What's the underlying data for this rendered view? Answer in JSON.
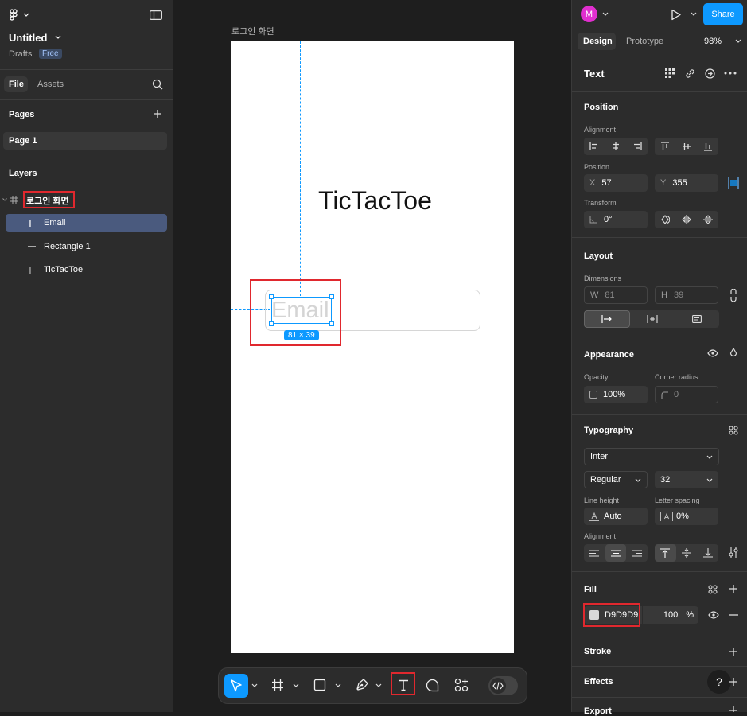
{
  "app": {
    "file_title": "Untitled",
    "drafts_label": "Drafts",
    "plan_badge": "Free",
    "avatar_initial": "M"
  },
  "left_panel": {
    "tabs": [
      "File",
      "Assets"
    ],
    "pages_heading": "Pages",
    "pages": [
      "Page 1"
    ],
    "layers_heading": "Layers",
    "layers": {
      "frame": "로그인 화면",
      "children": [
        {
          "name": "Email",
          "icon": "text-icon",
          "selected": true
        },
        {
          "name": "Rectangle 1",
          "icon": "rectangle-icon",
          "selected": false
        },
        {
          "name": "TicTacToe",
          "icon": "text-icon",
          "selected": false
        }
      ]
    }
  },
  "canvas": {
    "frame_label": "로그인 화면",
    "title_text": "TicTacToe",
    "email_placeholder": "Email",
    "selection_size": "81 × 39"
  },
  "right_panel": {
    "share_label": "Share",
    "tabs": [
      "Design",
      "Prototype"
    ],
    "zoom": "98%",
    "selection_type": "Text",
    "position": {
      "heading": "Position",
      "alignment_caption": "Alignment",
      "position_caption": "Position",
      "x_label": "X",
      "x_value": "57",
      "y_label": "Y",
      "y_value": "355",
      "transform_caption": "Transform",
      "rotation": "0°"
    },
    "layout": {
      "heading": "Layout",
      "dimensions_caption": "Dimensions",
      "w_label": "W",
      "w_value": "81",
      "h_label": "H",
      "h_value": "39"
    },
    "appearance": {
      "heading": "Appearance",
      "opacity_caption": "Opacity",
      "opacity_value": "100%",
      "radius_caption": "Corner radius",
      "radius_value": "0"
    },
    "typography": {
      "heading": "Typography",
      "font_family": "Inter",
      "font_weight": "Regular",
      "font_size": "32",
      "line_height_caption": "Line height",
      "line_height_value": "Auto",
      "letter_spacing_caption": "Letter spacing",
      "letter_spacing_value": "0%",
      "alignment_caption": "Alignment"
    },
    "fill": {
      "heading": "Fill",
      "hex": "D9D9D9",
      "swatch_color": "#D9D9D9",
      "opacity": "100",
      "percent_sign": "%"
    },
    "stroke_heading": "Stroke",
    "effects_heading": "Effects",
    "export_heading": "Export",
    "help_label": "?"
  },
  "colors": {
    "accent": "#0d99ff",
    "highlight": "#e0282e",
    "selected_layer": "#4a5a7e"
  }
}
